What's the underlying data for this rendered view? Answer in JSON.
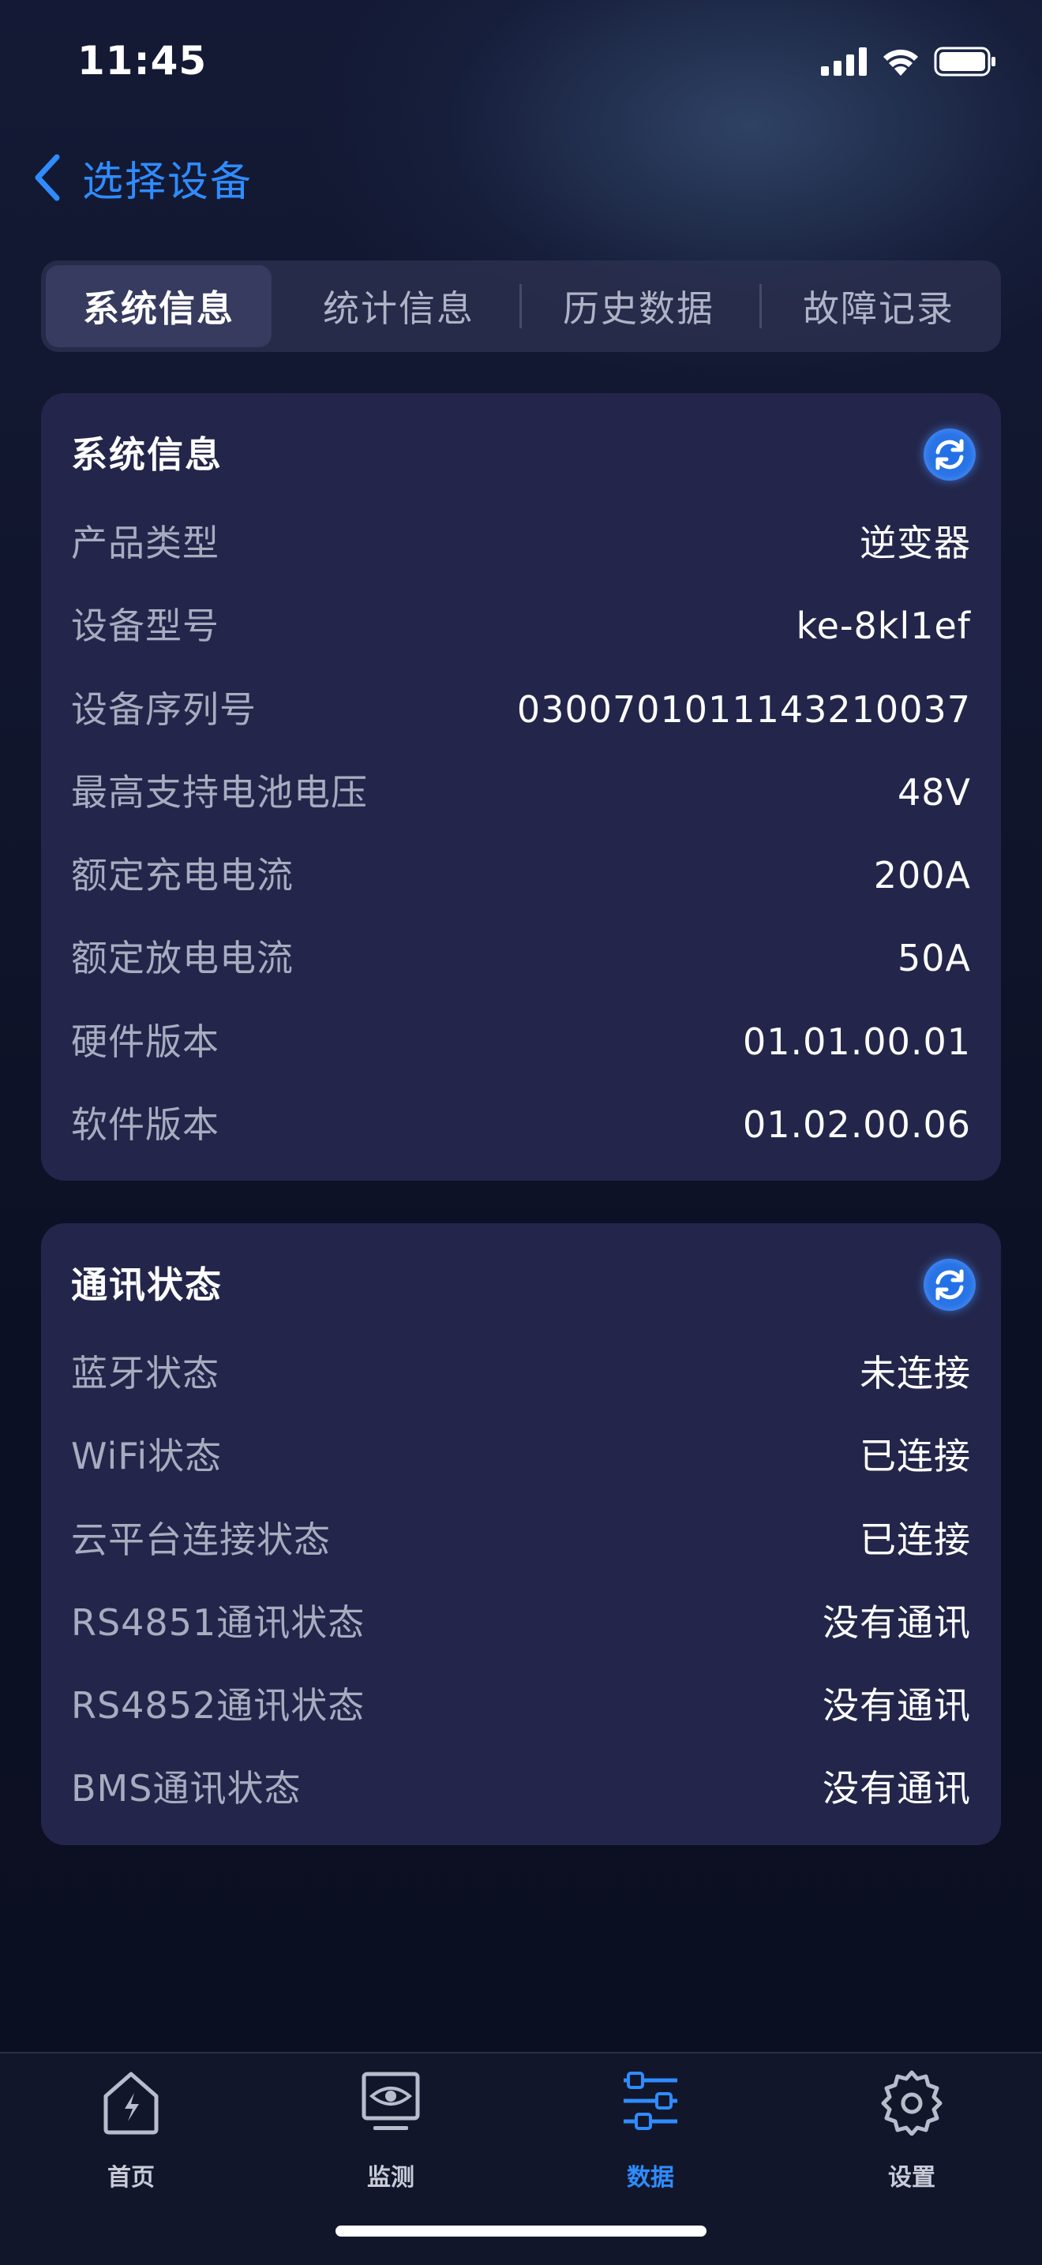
{
  "status_bar": {
    "time": "11:45"
  },
  "nav": {
    "back_title": "选择设备"
  },
  "tabs": [
    {
      "label": "系统信息",
      "active": true
    },
    {
      "label": "统计信息",
      "active": false
    },
    {
      "label": "历史数据",
      "active": false
    },
    {
      "label": "故障记录",
      "active": false
    }
  ],
  "system_info": {
    "title": "系统信息",
    "rows": [
      {
        "label": "产品类型",
        "value": "逆变器"
      },
      {
        "label": "设备型号",
        "value": "ke-8kl1ef"
      },
      {
        "label": "设备序列号",
        "value": "0300701011143210037"
      },
      {
        "label": "最高支持电池电压",
        "value": "48V"
      },
      {
        "label": "额定充电电流",
        "value": "200A"
      },
      {
        "label": "额定放电电流",
        "value": "50A"
      },
      {
        "label": "硬件版本",
        "value": "01.01.00.01"
      },
      {
        "label": "软件版本",
        "value": "01.02.00.06"
      }
    ]
  },
  "comm_status": {
    "title": "通讯状态",
    "rows": [
      {
        "label": "蓝牙状态",
        "value": "未连接"
      },
      {
        "label": "WiFi状态",
        "value": "已连接"
      },
      {
        "label": "云平台连接状态",
        "value": "已连接"
      },
      {
        "label": "RS4851通讯状态",
        "value": "没有通讯"
      },
      {
        "label": "RS4852通讯状态",
        "value": "没有通讯"
      },
      {
        "label": "BMS通讯状态",
        "value": "没有通讯"
      }
    ]
  },
  "bottom_nav": [
    {
      "label": "首页",
      "icon": "home-bolt-icon",
      "active": false
    },
    {
      "label": "监测",
      "icon": "monitor-eye-icon",
      "active": false
    },
    {
      "label": "数据",
      "icon": "sliders-data-icon",
      "active": true
    },
    {
      "label": "设置",
      "icon": "gear-icon",
      "active": false
    }
  ],
  "colors": {
    "accent": "#2f8cff",
    "card": "#23264a",
    "background": "#0c1023"
  }
}
